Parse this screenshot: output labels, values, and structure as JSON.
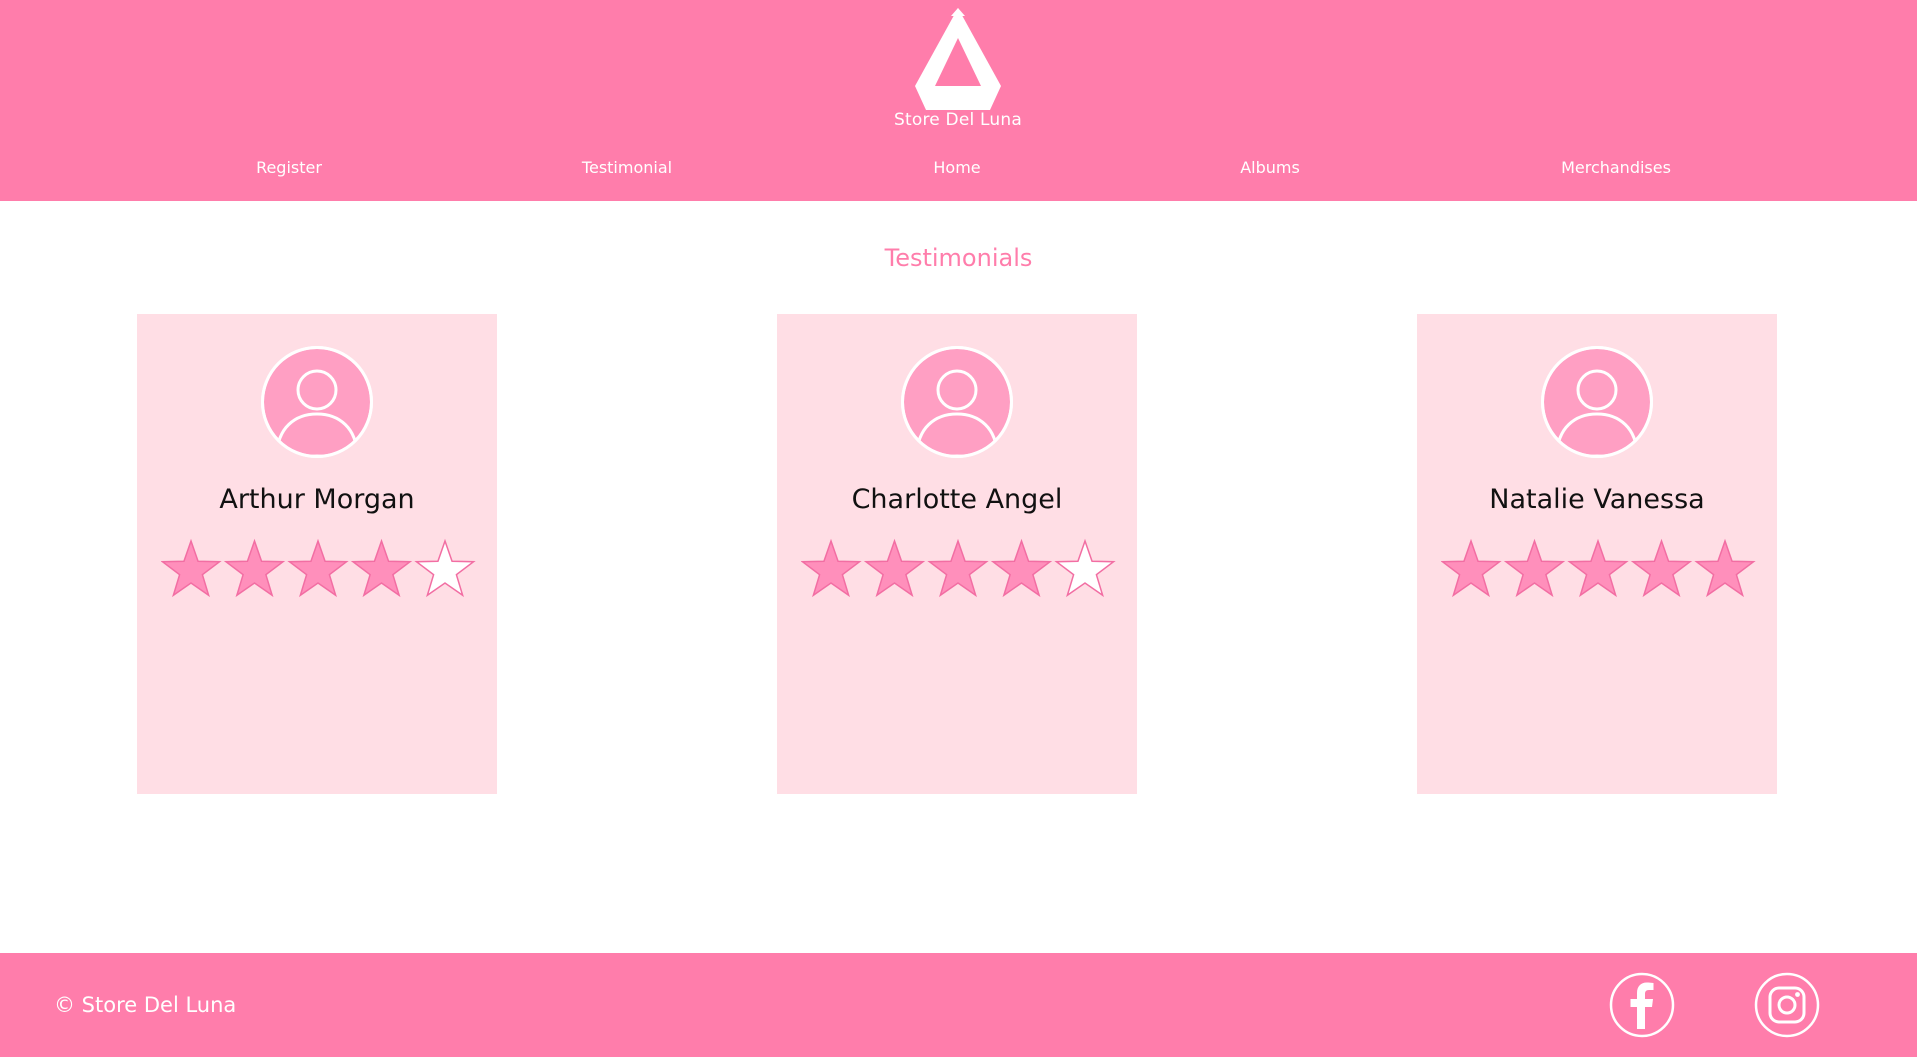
{
  "header": {
    "brand_name": "Store Del Luna",
    "nav": [
      {
        "label": "Register"
      },
      {
        "label": "Testimonial"
      },
      {
        "label": "Home"
      },
      {
        "label": "Albums"
      },
      {
        "label": "Merchandises"
      }
    ]
  },
  "main": {
    "title": "Testimonials",
    "testimonials": [
      {
        "name": "Arthur Morgan",
        "rating": 4,
        "max_rating": 5,
        "avatar_icon": "user-avatar-icon"
      },
      {
        "name": "Charlotte Angel",
        "rating": 4,
        "max_rating": 5,
        "avatar_icon": "user-avatar-icon"
      },
      {
        "name": "Natalie Vanessa",
        "rating": 5,
        "max_rating": 5,
        "avatar_icon": "user-avatar-icon"
      }
    ]
  },
  "footer": {
    "copyright": "© Store Del Luna",
    "social": [
      {
        "icon": "facebook-icon"
      },
      {
        "icon": "instagram-icon"
      }
    ]
  },
  "colors": {
    "brand_pink": "#ff7dab",
    "card_pink": "#ffdee5",
    "star_fill": "#ff8fbb",
    "star_stroke": "#f26ea3",
    "avatar_fill": "#ff9fc3"
  }
}
